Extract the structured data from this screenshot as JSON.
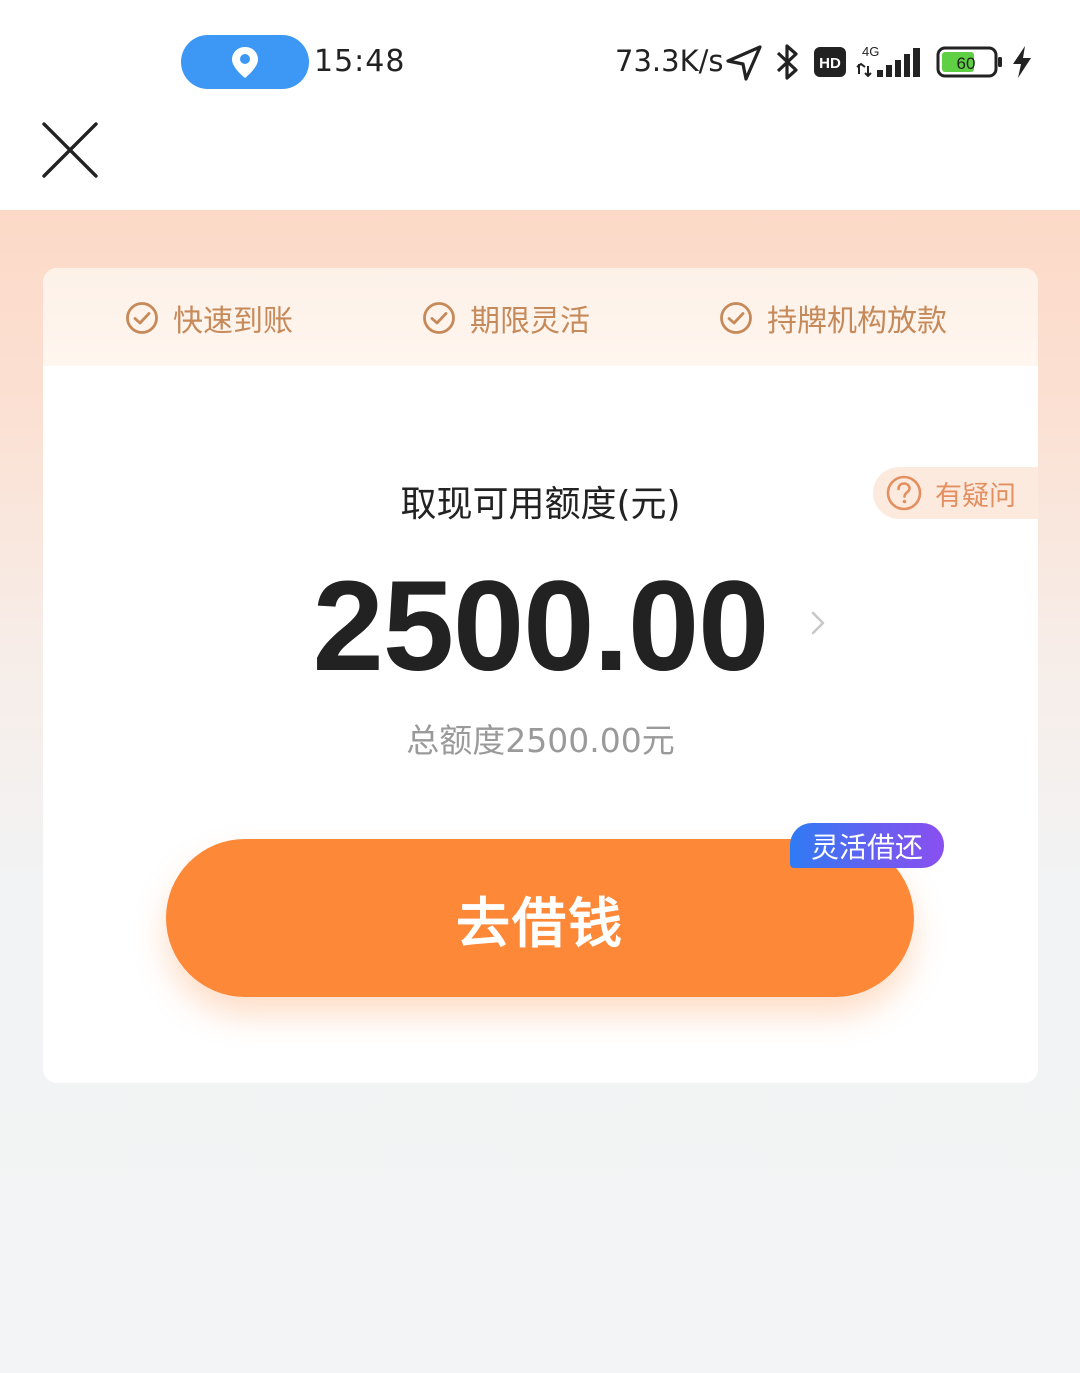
{
  "status_bar": {
    "time": "15:48",
    "net_speed": "73.3K/s",
    "network": "4G",
    "hd": "HD",
    "battery": "60",
    "icons": [
      "location-pin-icon",
      "navigation-icon",
      "bluetooth-icon",
      "hd-icon",
      "signal-icon",
      "battery-icon",
      "charging-icon"
    ]
  },
  "header": {
    "close_icon": "close-icon"
  },
  "features": [
    {
      "label": "快速到账"
    },
    {
      "label": "期限灵活"
    },
    {
      "label": "持牌机构放款"
    }
  ],
  "faq": {
    "label": "有疑问"
  },
  "quota": {
    "label": "取现可用额度(元)",
    "amount": "2500.00",
    "total": "总额度2500.00元"
  },
  "borrow_button": {
    "label": "去借钱",
    "badge": "灵活借还"
  },
  "colors": {
    "accent": "#fd8838",
    "feature_text": "#c68a5a",
    "badge_start": "#2f7bf5",
    "badge_end": "#8a4ff0",
    "location_pill": "#3d97f4"
  }
}
